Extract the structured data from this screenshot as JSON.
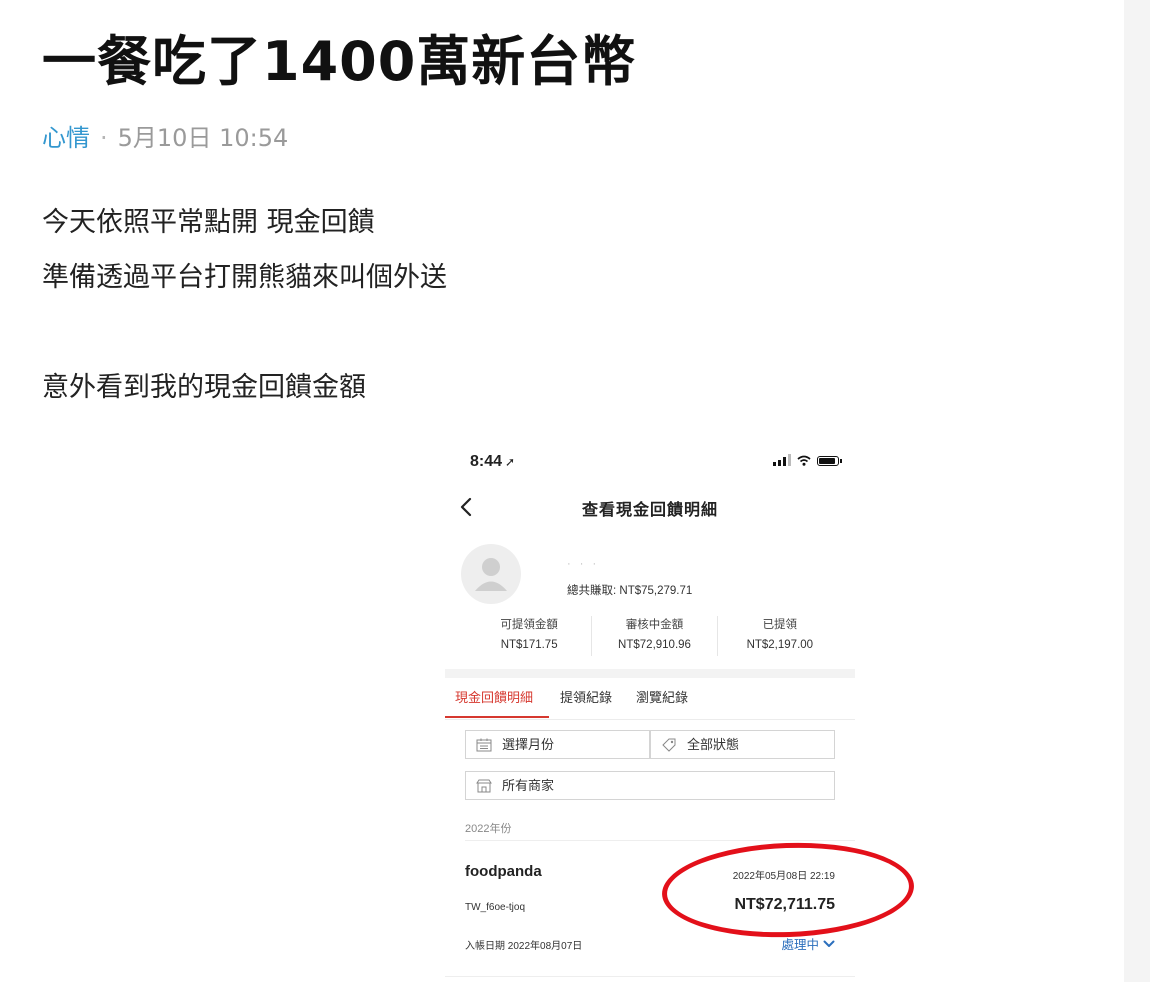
{
  "post": {
    "title": "一餐吃了1400萬新台幣",
    "board": "心情",
    "separator": "·",
    "time": "5月10日 10:54",
    "paragraphs": [
      "今天依照平常點開 現金回饋",
      "準備透過平台打開熊貓來叫個外送",
      "意外看到我的現金回饋金額"
    ]
  },
  "screenshot": {
    "status_time": "8:44",
    "screen_title": "查看現金回饋明細",
    "username_masked": "· · ·",
    "total_line": "總共賺取: NT$75,279.71",
    "stats": [
      {
        "label": "可提領金額",
        "value": "NT$171.75"
      },
      {
        "label": "審核中金額",
        "value": "NT$72,910.96"
      },
      {
        "label": "已提領",
        "value": "NT$2,197.00"
      }
    ],
    "tabs": [
      {
        "label": "現金回饋明細",
        "active": true
      },
      {
        "label": "提領紀錄",
        "active": false
      },
      {
        "label": "瀏覽紀錄",
        "active": false
      }
    ],
    "filters": {
      "month": "選擇月份",
      "status": "全部狀態",
      "merchant": "所有商家"
    },
    "year_label": "2022年份",
    "record": {
      "merchant": "foodpanda",
      "order_id": "TW_f6oe-tjoq",
      "posted_date": "入帳日期 2022年08月07日",
      "datetime": "2022年05月08日 22:19",
      "amount": "NT$72,711.75",
      "status": "處理中"
    }
  },
  "colors": {
    "board_link": "#3397cf",
    "active_tab": "#d6382f",
    "status_link": "#2c6fbd",
    "highlight_ring": "#e3101a"
  }
}
